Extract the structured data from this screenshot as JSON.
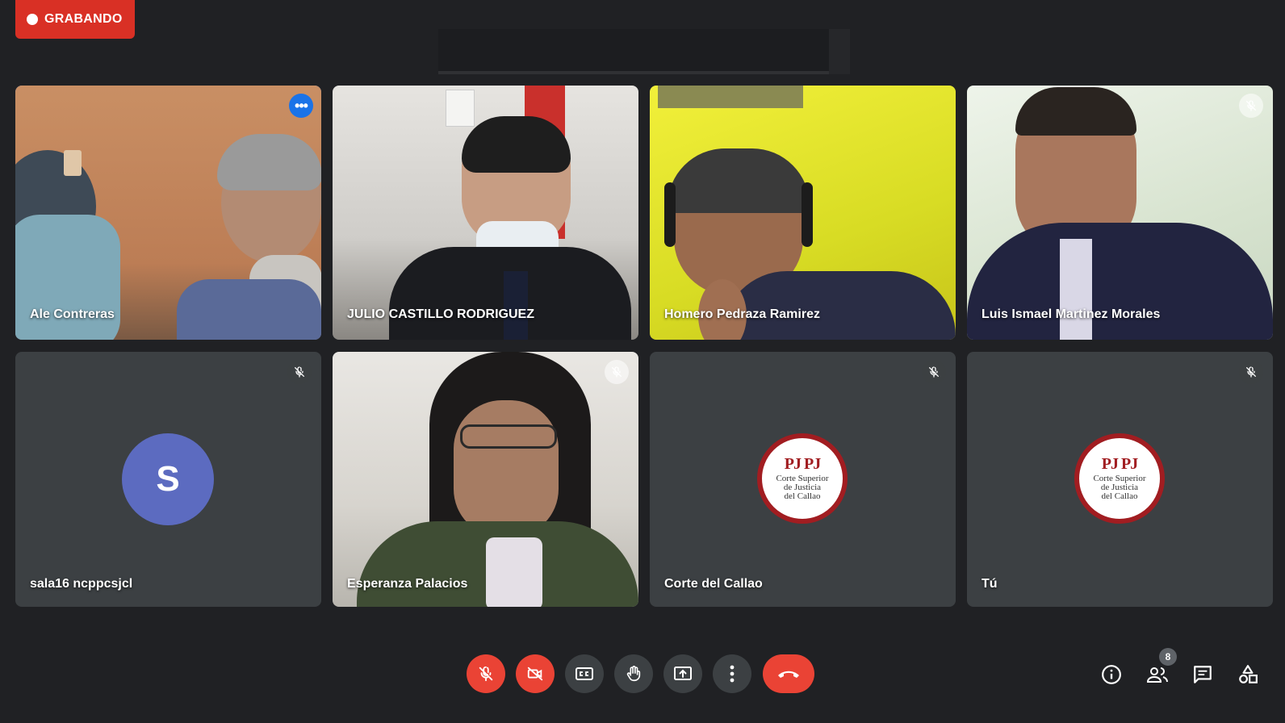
{
  "recording": {
    "label": "GRABANDO"
  },
  "participants": [
    {
      "name": "Ale Contreras"
    },
    {
      "name": "JULIO CASTILLO RODRIGUEZ"
    },
    {
      "name": "Homero Pedraza Ramirez"
    },
    {
      "name": "Luis Ismael Martinez Morales"
    },
    {
      "name": "sala16 ncppcsjcl",
      "avatar_letter": "S"
    },
    {
      "name": "Esperanza Palacios"
    },
    {
      "name": "Corte del Callao",
      "seal": {
        "mark": "PJ PJ",
        "line1": "Corte Superior",
        "line2": "de Justicia",
        "line3": "del Callao"
      }
    },
    {
      "name": "Tú",
      "seal": {
        "mark": "PJ PJ",
        "line1": "Corte Superior",
        "line2": "de Justicia",
        "line3": "del Callao"
      }
    }
  ],
  "people_count": "8",
  "colors": {
    "recording": "#d93025",
    "selected_outline": "#4a8af4",
    "danger": "#ea4335",
    "avatar": "#5c6bc0",
    "seal_border": "#a11d21"
  },
  "icons": [
    "mic-off-icon",
    "camera-off-icon",
    "captions-icon",
    "raise-hand-icon",
    "present-icon",
    "more-options-icon",
    "end-call-icon",
    "info-icon",
    "people-icon",
    "chat-icon",
    "activities-icon"
  ]
}
